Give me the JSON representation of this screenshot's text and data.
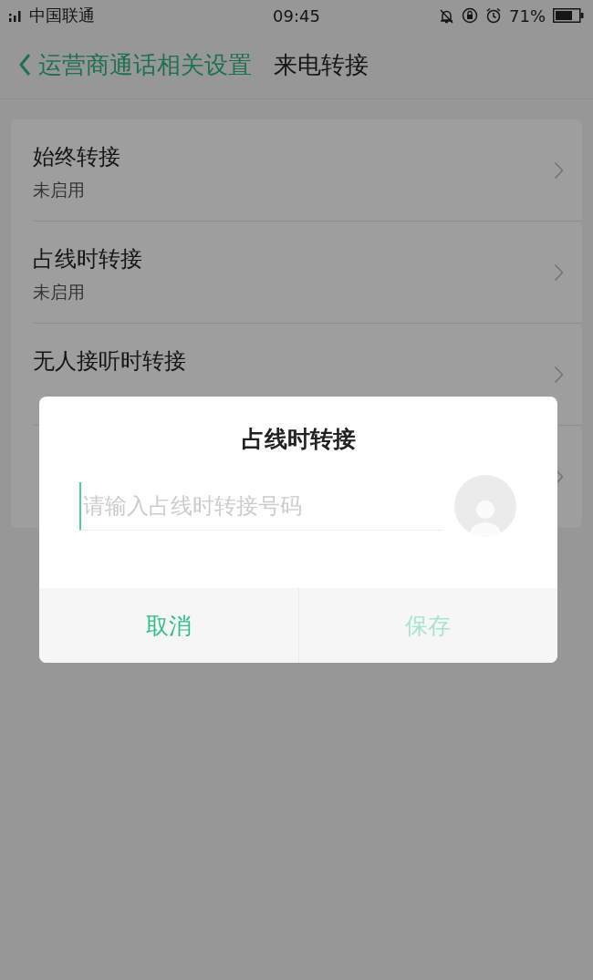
{
  "status_bar": {
    "carrier": "中国联通",
    "time": "09:45",
    "battery": "71%"
  },
  "header": {
    "back_label": "运营商通话相关设置",
    "title": "来电转接"
  },
  "settings": [
    {
      "title": "始终转接",
      "subtitle": "未启用"
    },
    {
      "title": "占线时转接",
      "subtitle": "未启用"
    },
    {
      "title": "无人接听时转接"
    }
  ],
  "dialog": {
    "title": "占线时转接",
    "input": {
      "placeholder": "请输入占线时转接号码"
    },
    "buttons": [
      {
        "label": "取消",
        "disabled": false
      },
      {
        "label": "保存",
        "disabled": true
      }
    ]
  }
}
